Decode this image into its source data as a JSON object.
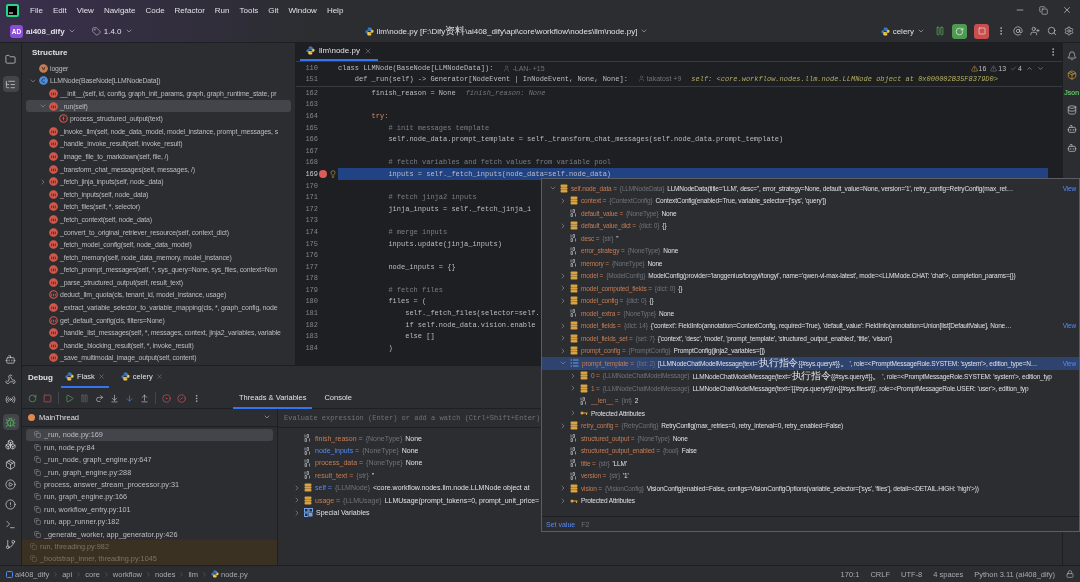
{
  "menu": [
    "File",
    "Edit",
    "View",
    "Navigate",
    "Code",
    "Refactor",
    "Run",
    "Tools",
    "Git",
    "Window",
    "Help"
  ],
  "toolbar": {
    "project_badge": "AD",
    "project": "ai408_dify",
    "branch": "1.4.0",
    "file_title": "llm\\node.py [F:\\Dify资料\\ai408_dify\\api\\core\\workflow\\nodes\\llm\\node.py]",
    "run_config": "celery"
  },
  "structure": {
    "title": "Structure",
    "items": [
      {
        "kind": "variable",
        "label": "logger",
        "selected": false
      },
      {
        "kind": "class",
        "label": "LLMNode(BaseNode[LLMNodeData])",
        "selected": false,
        "expanded": true,
        "children": [
          {
            "kind": "method",
            "label": "__init__(self, id, config, graph_init_params, graph, graph_runtime_state, pr",
            "selected": false
          },
          {
            "kind": "method",
            "label": "_run(self)",
            "selected": true,
            "expanded": true,
            "children": [
              {
                "kind": "function",
                "label": "process_structured_output(text)",
                "selected": false
              }
            ]
          },
          {
            "kind": "method",
            "label": "_invoke_llm(self, node_data_model, model_instance, prompt_messages, s",
            "selected": false
          },
          {
            "kind": "method",
            "label": "_handle_invoke_result(self, invoke_result)",
            "selected": false
          },
          {
            "kind": "method",
            "label": "_image_file_to_markdown(self, file, /)",
            "selected": false
          },
          {
            "kind": "method",
            "label": "_transform_chat_messages(self, messages, /)",
            "selected": false
          },
          {
            "kind": "method",
            "label": "_fetch_jinja_inputs(self, node_data)",
            "selected": false,
            "expanded": false
          },
          {
            "kind": "method",
            "label": "_fetch_inputs(self, node_data)",
            "selected": false
          },
          {
            "kind": "method",
            "label": "_fetch_files(self, *, selector)",
            "selected": false
          },
          {
            "kind": "method",
            "label": "_fetch_context(self, node_data)",
            "selected": false
          },
          {
            "kind": "method",
            "label": "_convert_to_original_retriever_resource(self, context_dict)",
            "selected": false
          },
          {
            "kind": "method",
            "label": "_fetch_model_config(self, node_data_model)",
            "selected": false
          },
          {
            "kind": "method",
            "label": "_fetch_memory(self, node_data_memory, model_instance)",
            "selected": false
          },
          {
            "kind": "method",
            "label": "_fetch_prompt_messages(self, *, sys_query=None, sys_files, context=Non",
            "selected": false
          },
          {
            "kind": "method",
            "label": "_parse_structured_output(self, result_text)",
            "selected": false
          },
          {
            "kind": "static",
            "label": "deduct_llm_quota(cls, tenant_id, model_instance, usage)",
            "selected": false
          },
          {
            "kind": "method",
            "label": "_extract_variable_selector_to_variable_mapping(cls, *, graph_config, node",
            "selected": false
          },
          {
            "kind": "static",
            "label": "get_default_config(cls, filters=None)",
            "selected": false
          },
          {
            "kind": "method",
            "label": "_handle_list_messages(self, *, messages, context, jinja2_variables, variable",
            "selected": false
          },
          {
            "kind": "method",
            "label": "_handle_blocking_result(self, *, invoke_result)",
            "selected": false
          },
          {
            "kind": "method",
            "label": "_save_multimodal_image_output(self, content)",
            "selected": false
          }
        ]
      }
    ]
  },
  "editor": {
    "tab": {
      "label": "llm\\node.py",
      "selected": true
    },
    "inspections": {
      "warnings": "16",
      "weak_warnings": "13",
      "passed": "4"
    },
    "sticky": [
      {
        "number": "110",
        "code": "class LLMNode(BaseNode[LLMNodeData]):",
        "author": "-LAN- +15"
      },
      {
        "number": "151",
        "code": "    def _run(self) -> Generator[NodeEvent | InNodeEvent, None, None]:",
        "author": "takatost +9",
        "hint": "self: <core.workflow.nodes.llm.node.LLMNode object at 0x000002B35F8379D0>"
      }
    ],
    "lines": [
      {
        "number": "162",
        "kind": "code",
        "code": "        finish_reason = None",
        "hint": "finish_reason: None",
        "current": false,
        "breakpoint": false
      },
      {
        "number": "163",
        "current": false,
        "breakpoint": false
      },
      {
        "number": "164",
        "kind": "keyword",
        "code": "        try:",
        "current": false,
        "breakpoint": false
      },
      {
        "number": "165",
        "kind": "comment",
        "code": "            # init messages template",
        "current": false,
        "breakpoint": false
      },
      {
        "number": "166",
        "kind": "code",
        "code": "            self.node_data.prompt_template = self._transform_chat_messages(self.node_data.prompt_template)",
        "current": false,
        "breakpoint": false
      },
      {
        "number": "167",
        "current": false,
        "breakpoint": false
      },
      {
        "number": "168",
        "kind": "comment",
        "code": "            # fetch variables and fetch values from variable pool",
        "current": false,
        "breakpoint": false
      },
      {
        "number": "169",
        "kind": "code",
        "code": "            inputs = self._fetch_inputs(node_data=self.node_data)",
        "current": true,
        "breakpoint": true
      },
      {
        "number": "170",
        "current": false,
        "breakpoint": false
      },
      {
        "number": "171",
        "kind": "comment",
        "code": "            # fetch jinja2 inputs",
        "current": false,
        "breakpoint": false
      },
      {
        "number": "172",
        "kind": "code",
        "code": "            jinja_inputs = self._fetch_jinja_i",
        "current": false,
        "breakpoint": false
      },
      {
        "number": "173",
        "current": false,
        "breakpoint": false
      },
      {
        "number": "174",
        "kind": "comment",
        "code": "            # merge inputs",
        "current": false,
        "breakpoint": false
      },
      {
        "number": "175",
        "kind": "code",
        "code": "            inputs.update(jinja_inputs)",
        "current": false,
        "breakpoint": false
      },
      {
        "number": "176",
        "current": false,
        "breakpoint": false
      },
      {
        "number": "177",
        "kind": "code",
        "code": "            node_inputs = {}",
        "current": false,
        "breakpoint": false
      },
      {
        "number": "178",
        "current": false,
        "breakpoint": false
      },
      {
        "number": "179",
        "kind": "comment",
        "code": "            # fetch files",
        "current": false,
        "breakpoint": false
      },
      {
        "number": "180",
        "kind": "code",
        "code": "            files = (",
        "current": false,
        "breakpoint": false
      },
      {
        "number": "181",
        "kind": "code",
        "code": "                self._fetch_files(selector=self.",
        "current": false,
        "breakpoint": false
      },
      {
        "number": "182",
        "kind": "code",
        "code": "                if self.node_data.vision.enable",
        "current": false,
        "breakpoint": false
      },
      {
        "number": "183",
        "kind": "code",
        "code": "                else []",
        "current": false,
        "breakpoint": false
      },
      {
        "number": "184",
        "kind": "code",
        "code": "            )",
        "current": false,
        "breakpoint": false
      }
    ]
  },
  "right_strip_label": "Json",
  "debug": {
    "title": "Debug",
    "sessions": [
      {
        "label": "Flask",
        "selected": true
      },
      {
        "label": "celery",
        "selected": false
      }
    ],
    "tabs": [
      {
        "label": "Threads & Variables",
        "selected": true
      },
      {
        "label": "Console",
        "selected": false
      }
    ],
    "thread": "MainThread",
    "frames": [
      {
        "label": "_run, node.py:169",
        "selected": true,
        "kind": "user"
      },
      {
        "label": "run, node.py:84",
        "selected": false,
        "kind": "user"
      },
      {
        "label": "_run_node, graph_engine.py:647",
        "selected": false,
        "kind": "user"
      },
      {
        "label": "_run, graph_engine.py:288",
        "selected": false,
        "kind": "user"
      },
      {
        "label": "process, answer_stream_processor.py:31",
        "selected": false,
        "kind": "user"
      },
      {
        "label": "run, graph_engine.py:166",
        "selected": false,
        "kind": "user"
      },
      {
        "label": "run, workflow_entry.py:101",
        "selected": false,
        "kind": "user"
      },
      {
        "label": "run, app_runner.py:182",
        "selected": false,
        "kind": "user"
      },
      {
        "label": "_generate_worker, app_generator.py:426",
        "selected": false,
        "kind": "user"
      },
      {
        "label": "run, threading.py:982",
        "selected": false,
        "kind": "library"
      },
      {
        "label": "_bootstrap_inner, threading.py:1045",
        "selected": false,
        "kind": "library"
      }
    ],
    "evaluate_placeholder": "Evaluate expression (Enter) or add a watch (Ctrl+Shift+Enter)",
    "variables": [
      {
        "kind": "primitive",
        "name": "finish_reason =",
        "type": "{NoneType}",
        "value": "None",
        "changed": false
      },
      {
        "kind": "primitive",
        "name": "node_inputs =",
        "type": "{NoneType}",
        "value": "None",
        "changed": true
      },
      {
        "kind": "primitive",
        "name": "process_data =",
        "type": "{NoneType}",
        "value": "None",
        "changed": false
      },
      {
        "kind": "primitive",
        "name": "result_text =",
        "type": "{str}",
        "value": "''",
        "changed": false
      },
      {
        "kind": "object",
        "name": "self =",
        "type": "{LLMNode}",
        "value": "<core.workflow.nodes.llm.node.LLMNode object at",
        "changed": true,
        "expanded": false
      },
      {
        "kind": "object",
        "name": "usage =",
        "type": "{LLMUsage}",
        "value": "LLMUsage(prompt_tokens=0, prompt_unit_price=",
        "changed": false,
        "expanded": false
      },
      {
        "kind": "special",
        "name": "Special Variables",
        "expanded": false
      }
    ]
  },
  "popup": {
    "tree": [
      {
        "kind": "object",
        "name": "self.node_data =",
        "type": "{LLMNodeData}",
        "value": "LLMNodeData(title='LLM', desc='', error_strategy=None, default_value=None, version='1', retry_config=RetryConfig(max_ret…",
        "link": "View",
        "expanded": true,
        "selected": false,
        "children": [
          {
            "kind": "object",
            "name": "context =",
            "type": "{ContextConfig}",
            "value": "ContextConfig(enabled=True, variable_selector=['sys', 'query'])",
            "expanded": false,
            "selected": false
          },
          {
            "kind": "primitive",
            "name": "default_value =",
            "type": "{NoneType}",
            "value": "None",
            "selected": false
          },
          {
            "kind": "object",
            "name": "default_value_dict =",
            "type": "{dict: 0}",
            "value": "{}",
            "expanded": false,
            "selected": false
          },
          {
            "kind": "primitive",
            "name": "desc =",
            "type": "{str}",
            "value": "''",
            "selected": false
          },
          {
            "kind": "primitive",
            "name": "error_strategy =",
            "type": "{NoneType}",
            "value": "None",
            "selected": false
          },
          {
            "kind": "primitive",
            "name": "memory =",
            "type": "{NoneType}",
            "value": "None",
            "selected": false
          },
          {
            "kind": "object",
            "name": "model =",
            "type": "{ModelConfig}",
            "value": "ModelConfig(provider='langgenius/tongyi/tongyi', name='qwen-vl-max-latest', mode=<LLMMode.CHAT: 'chat'>, completion_params={})",
            "expanded": false,
            "selected": false
          },
          {
            "kind": "object",
            "name": "model_computed_fields =",
            "type": "{dict: 0}",
            "value": "{}",
            "expanded": false,
            "selected": false
          },
          {
            "kind": "object",
            "name": "model_config =",
            "type": "{dict: 0}",
            "value": "{}",
            "expanded": false,
            "selected": false
          },
          {
            "kind": "primitive",
            "name": "model_extra =",
            "type": "{NoneType}",
            "value": "None",
            "selected": false
          },
          {
            "kind": "object",
            "name": "model_fields =",
            "type": "{dict: 14}",
            "value": "{'context': FieldInfo(annotation=ContextConfig, required=True), 'default_value': FieldInfo(annotation=Union[list[DefaultValue], None…",
            "link": "View",
            "expanded": false,
            "selected": false
          },
          {
            "kind": "object",
            "name": "model_fields_set =",
            "type": "{set: 7}",
            "value": "{'context', 'desc', 'model', 'prompt_template', 'structured_output_enabled', 'title', 'vision'}",
            "expanded": false,
            "selected": false
          },
          {
            "kind": "object",
            "name": "prompt_config =",
            "type": "{PromptConfig}",
            "value": "PromptConfig(jinja2_variables=[])",
            "expanded": false,
            "selected": false
          },
          {
            "kind": "list",
            "name": "prompt_template =",
            "type": "{list: 2}",
            "value": "[LLMNodeChatModelMessage(text='执行指令{{#sys.query#}}。', role=<PromptMessageRole.SYSTEM: 'system'>, edition_type=N…",
            "link": "View",
            "expanded": true,
            "selected": true,
            "children": [
              {
                "kind": "object",
                "name": "0 =",
                "type": "{LLMNodeChatModelMessage}",
                "value": "LLMNodeChatModelMessage(text='执行指令{{#sys.query#}}。', role=<PromptMessageRole.SYSTEM: 'system'>, edition_typ",
                "expanded": false,
                "selected": false
              },
              {
                "kind": "object",
                "name": "1 =",
                "type": "{LLMNodeChatModelMessage}",
                "value": "LLMNodeChatModelMessage(text='{{#sys.query#}}\\n{{#sys.files#}}', role=<PromptMessageRole.USER: 'user'>, edition_typ",
                "expanded": false,
                "selected": false
              },
              {
                "kind": "primitive",
                "name": "__len__ =",
                "type": "{int}",
                "value": "2",
                "selected": false
              },
              {
                "kind": "protected",
                "name": "Protected Attributes",
                "expanded": false,
                "selected": false
              }
            ]
          },
          {
            "kind": "object",
            "name": "retry_config =",
            "type": "{RetryConfig}",
            "value": "RetryConfig(max_retries=0, retry_interval=0, retry_enabled=False)",
            "expanded": false,
            "selected": false
          },
          {
            "kind": "primitive",
            "name": "structured_output =",
            "type": "{NoneType}",
            "value": "None",
            "selected": false
          },
          {
            "kind": "primitive",
            "name": "structured_output_enabled =",
            "type": "{bool}",
            "value": "False",
            "selected": false
          },
          {
            "kind": "primitive",
            "name": "title =",
            "type": "{str}",
            "value": "'LLM'",
            "selected": false
          },
          {
            "kind": "primitive",
            "name": "version =",
            "type": "{str}",
            "value": "'1'",
            "selected": false
          },
          {
            "kind": "object",
            "name": "vision =",
            "type": "{VisionConfig}",
            "value": "VisionConfig(enabled=False, configs=VisionConfigOptions(variable_selector=['sys', 'files'], detail=<DETAIL.HIGH: 'high'>))",
            "expanded": false,
            "selected": false
          },
          {
            "kind": "protected",
            "name": "Protected Attributes",
            "expanded": false,
            "selected": false
          }
        ]
      }
    ],
    "footer": {
      "action": "Set value",
      "shortcut": "F2"
    }
  },
  "status_bar": {
    "breadcrumb": [
      "ai408_dify",
      "api",
      "core",
      "workflow",
      "nodes",
      "llm",
      "node.py"
    ],
    "items": [
      "170:1",
      "CRLF",
      "UTF-8",
      "4 spaces",
      "Python 3.11 (ai408_dify)"
    ]
  }
}
